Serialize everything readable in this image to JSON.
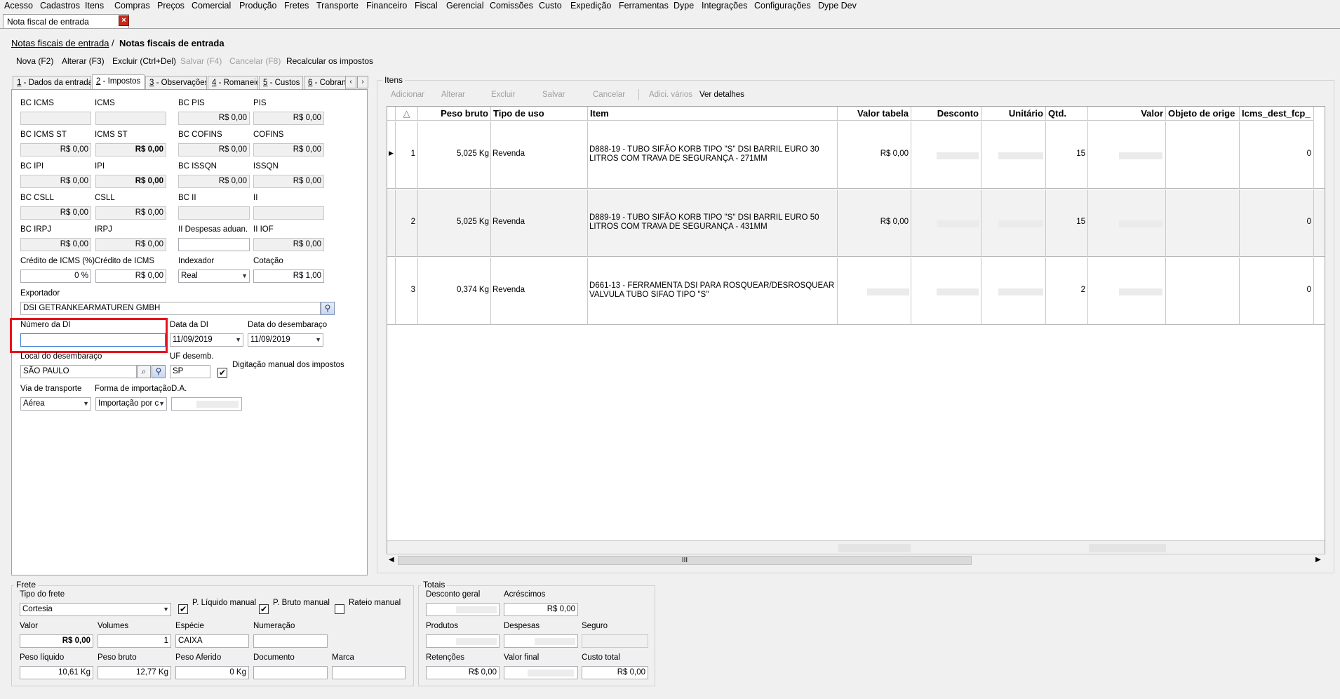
{
  "menu": [
    "Acesso",
    "Cadastros",
    "Itens",
    "Compras",
    "Preços",
    "Comercial",
    "Produção",
    "Fretes",
    "Transporte",
    "Financeiro",
    "Fiscal",
    "Gerencial",
    "Comissões",
    "Custo",
    "Expedição",
    "Ferramentas",
    "Dype",
    "Integrações",
    "Configurações",
    "Dype Dev"
  ],
  "doc_tab": {
    "title": "Nota fiscal de entrada",
    "close": "×"
  },
  "breadcrumb": {
    "parent": "Notas fiscais de entrada",
    "separator": "/",
    "current": "Notas fiscais de entrada"
  },
  "toolbar": {
    "nova": "Nova (F2)",
    "alterar": "Alterar (F3)",
    "excluir": "Excluir (Ctrl+Del)",
    "salvar": "Salvar (F4)",
    "cancelar": "Cancelar (F8)",
    "recalcular": "Recalcular os impostos"
  },
  "tabs": [
    {
      "num": "1",
      "label": " - Dados da entrada"
    },
    {
      "num": "2",
      "label": " - Impostos"
    },
    {
      "num": "3",
      "label": " - Observações"
    },
    {
      "num": "4",
      "label": " - Romaneio"
    },
    {
      "num": "5",
      "label": " - Custos"
    },
    {
      "num": "6",
      "label": " - Cobranç"
    }
  ],
  "tab_scroll": {
    "left": "‹",
    "right": "›"
  },
  "impostos": {
    "bc_icms": {
      "label": "BC ICMS",
      "value": ""
    },
    "icms": {
      "label": "ICMS",
      "value": ""
    },
    "bc_pis": {
      "label": "BC PIS",
      "value": "R$ 0,00"
    },
    "pis": {
      "label": "PIS",
      "value": "R$ 0,00"
    },
    "bc_icms_st": {
      "label": "BC ICMS ST",
      "value": "R$ 0,00"
    },
    "icms_st": {
      "label": "ICMS ST",
      "value": "R$ 0,00"
    },
    "bc_cofins": {
      "label": "BC COFINS",
      "value": "R$ 0,00"
    },
    "cofins": {
      "label": "COFINS",
      "value": "R$ 0,00"
    },
    "bc_ipi": {
      "label": "BC IPI",
      "value": "R$ 0,00"
    },
    "ipi": {
      "label": "IPI",
      "value": "R$ 0,00"
    },
    "bc_issqn": {
      "label": "BC ISSQN",
      "value": "R$ 0,00"
    },
    "issqn": {
      "label": "ISSQN",
      "value": "R$ 0,00"
    },
    "bc_csll": {
      "label": "BC CSLL",
      "value": "R$ 0,00"
    },
    "csll": {
      "label": "CSLL",
      "value": "R$ 0,00"
    },
    "bc_ii": {
      "label": "BC II",
      "value": ""
    },
    "ii": {
      "label": "II",
      "value": ""
    },
    "bc_irpj": {
      "label": "BC IRPJ",
      "value": "R$ 0,00"
    },
    "irpj": {
      "label": "IRPJ",
      "value": "R$ 0,00"
    },
    "ii_despesas": {
      "label": "II Despesas aduan.",
      "value": ""
    },
    "ii_iof": {
      "label": "II IOF",
      "value": "R$ 0,00"
    },
    "credito_icms_pct": {
      "label": "Crédito de ICMS (%)",
      "value": "0 %"
    },
    "credito_icms": {
      "label": "Crédito de ICMS",
      "value": "R$ 0,00"
    },
    "indexador": {
      "label": "Indexador",
      "value": "Real"
    },
    "cotacao": {
      "label": "Cotação",
      "value": "R$ 1,00"
    },
    "exportador": {
      "label": "Exportador",
      "value": "DSI GETRANKEARMATUREN GMBH"
    },
    "numero_di": {
      "label": "Número da DI",
      "value": ""
    },
    "data_di": {
      "label": "Data da DI",
      "value": "11/09/2019"
    },
    "data_desembaraco": {
      "label": "Data do desembaraço",
      "value": "11/09/2019"
    },
    "local_desembaraco": {
      "label": "Local do desembaraço",
      "value": "SÃO PAULO"
    },
    "uf_desemb": {
      "label": "UF desemb.",
      "value": "SP"
    },
    "digitacao_manual": {
      "label": "Digitação manual dos impostos",
      "checked": true
    },
    "via_transporte": {
      "label": "Via de transporte",
      "value": "Aérea"
    },
    "forma_importacao": {
      "label": "Forma de importação",
      "value": "Importação por c"
    },
    "da": {
      "label": "D.A.",
      "value": ""
    }
  },
  "itens": {
    "group_label": "Itens",
    "toolbar": {
      "adicionar": "Adicionar",
      "alterar": "Alterar",
      "excluir": "Excluir",
      "salvar": "Salvar",
      "cancelar": "Cancelar",
      "adic_varios": "Adici. vários",
      "ver_detalhes": "Ver detalhes"
    },
    "columns": [
      "",
      "△",
      "Peso bruto",
      "Tipo de uso",
      "Item",
      "Valor tabela",
      "Desconto",
      "Unitário",
      "Qtd.",
      "Valor",
      "Objeto de orige",
      "Icms_dest_fcp_"
    ],
    "rows": [
      {
        "n": "1",
        "peso": "5,025 Kg",
        "tipo": "Revenda",
        "item": "D888-19 - TUBO SIFÃO KORB TIPO \"S\" DSI BARRIL EURO 30 LITROS COM TRAVA DE SEGURANÇA - 271MM",
        "valor_tabela": "R$ 0,00",
        "qtd": "15",
        "icms": "0"
      },
      {
        "n": "2",
        "peso": "5,025 Kg",
        "tipo": "Revenda",
        "item": "D889-19 - TUBO SIFÃO KORB TIPO \"S\" DSI BARRIL EURO 50 LITROS COM TRAVA DE SEGURANÇA - 431MM",
        "valor_tabela": "R$ 0,00",
        "qtd": "15",
        "icms": "0"
      },
      {
        "n": "3",
        "peso": "0,374 Kg",
        "tipo": "Revenda",
        "item": "D661-13 - FERRAMENTA DSI PARA ROSQUEAR/DESROSQUEAR VALVULA TUBO SIFAO TIPO \"S\"",
        "valor_tabela": "",
        "qtd": "2",
        "icms": "0"
      }
    ],
    "scroll_grip": "III"
  },
  "frete": {
    "group_label": "Frete",
    "tipo_frete": {
      "label": "Tipo do frete",
      "value": "Cortesia"
    },
    "p_liquido_manual": {
      "label": "P. Líquido manual",
      "checked": true
    },
    "p_bruto_manual": {
      "label": "P. Bruto manual",
      "checked": true
    },
    "rateio_manual": {
      "label": "Rateio manual",
      "checked": false
    },
    "valor": {
      "label": "Valor",
      "value": "R$ 0,00"
    },
    "volumes": {
      "label": "Volumes",
      "value": "1"
    },
    "especie": {
      "label": "Espécie",
      "value": "CAIXA"
    },
    "numeracao": {
      "label": "Numeração",
      "value": ""
    },
    "peso_liquido": {
      "label": "Peso líquido",
      "value": "10,61 Kg"
    },
    "peso_bruto": {
      "label": "Peso bruto",
      "value": "12,77 Kg"
    },
    "peso_aferido": {
      "label": "Peso Aferido",
      "value": "0 Kg"
    },
    "documento": {
      "label": "Documento",
      "value": ""
    },
    "marca": {
      "label": "Marca",
      "value": ""
    }
  },
  "totais": {
    "group_label": "Totais",
    "desconto_geral": {
      "label": "Desconto geral",
      "value": ""
    },
    "acrescimos": {
      "label": "Acréscimos",
      "value": "R$ 0,00"
    },
    "produtos": {
      "label": "Produtos",
      "value": ""
    },
    "despesas": {
      "label": "Despesas",
      "value": ""
    },
    "seguro": {
      "label": "Seguro",
      "value": ""
    },
    "retencoes": {
      "label": "Retenções",
      "value": "R$ 0,00"
    },
    "valor_final": {
      "label": "Valor final",
      "value": ""
    },
    "custo_total": {
      "label": "Custo total",
      "value": "R$ 0,00"
    }
  },
  "colors": {
    "highlight_box": "#e8131c",
    "close_button": "#c42b1c",
    "row_alt": "#f2f2f2"
  },
  "icons": {
    "search": "binoculars-icon",
    "lookup": "magnifier-icon",
    "checkmark": "✔"
  }
}
